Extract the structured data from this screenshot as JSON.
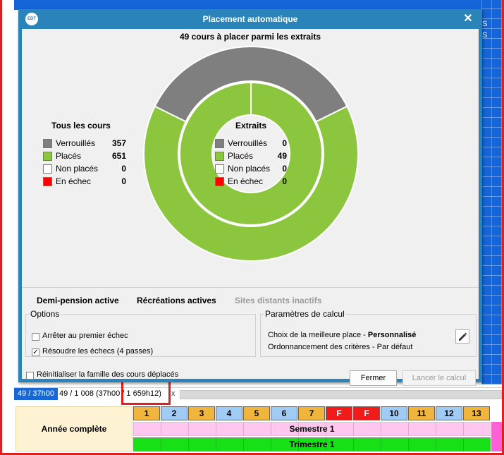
{
  "background": {
    "side_labels": [
      "S",
      "S"
    ],
    "status": {
      "selection": "49 / 37h00",
      "summary": "49 / 1 008  (37h00 / 1 659h12)",
      "close": "x"
    },
    "calendar": {
      "row_label": "Année complète",
      "weeks": [
        {
          "label": "1",
          "color": "#f0b53c"
        },
        {
          "label": "2",
          "color": "#9fcbf5"
        },
        {
          "label": "3",
          "color": "#f0b53c"
        },
        {
          "label": "4",
          "color": "#9fcbf5"
        },
        {
          "label": "5",
          "color": "#f0b53c"
        },
        {
          "label": "6",
          "color": "#9fcbf5"
        },
        {
          "label": "7",
          "color": "#f0b53c"
        },
        {
          "label": "F",
          "color": "#f21b1b"
        },
        {
          "label": "F",
          "color": "#f21b1b"
        },
        {
          "label": "10",
          "color": "#9fcbf5"
        },
        {
          "label": "11",
          "color": "#f0b53c"
        },
        {
          "label": "12",
          "color": "#9fcbf5"
        },
        {
          "label": "13",
          "color": "#f0b53c"
        }
      ],
      "semestre": "Semestre 1",
      "trimestre": "Trimestre 1"
    }
  },
  "dialog": {
    "logo": "EDT",
    "title": "Placement automatique",
    "close": "✕",
    "headline": "49 cours à placer parmi les extraits",
    "all_courses": {
      "title": "Tous les cours",
      "rows": [
        {
          "label": "Verrouillés",
          "value": "357",
          "count": 357,
          "color": "#7f7f7f"
        },
        {
          "label": "Placés",
          "value": "651",
          "count": 651,
          "color": "#8cc63e"
        },
        {
          "label": "Non placés",
          "value": "0",
          "count": 0,
          "color": "#ffffff"
        },
        {
          "label": "En échec",
          "value": "0",
          "count": 0,
          "color": "#ff0000"
        }
      ]
    },
    "extracts": {
      "title": "Extraits",
      "rows": [
        {
          "label": "Verrouillés",
          "value": "0",
          "count": 0,
          "color": "#7f7f7f"
        },
        {
          "label": "Placés",
          "value": "49",
          "count": 49,
          "color": "#8cc63e"
        },
        {
          "label": "Non placés",
          "value": "0",
          "count": 0,
          "color": "#ffffff"
        },
        {
          "label": "En échec",
          "value": "0",
          "count": 0,
          "color": "#ff0000"
        }
      ]
    },
    "features": {
      "demi_pension": "Demi-pension active",
      "recreations": "Récréations actives",
      "sites": "Sites distants inactifs"
    },
    "options": {
      "legend": "Options",
      "stop_first_failure": "Arrêter au premier échec",
      "stop_first_failure_checked": false,
      "resolve_failures": "Résoudre les échecs (4 passes)",
      "resolve_failures_checked": true
    },
    "params": {
      "legend": "Paramètres de calcul",
      "best_place_label": "Choix de la meilleure place - ",
      "best_place_value": "Personnalisé",
      "ordering": "Ordonnancement des critères - Par défaut"
    },
    "reset_family": "Réinitialiser la famille des cours déplacés",
    "reset_family_checked": false,
    "close_button": "Fermer",
    "run_button": "Lancer le calcul"
  }
}
